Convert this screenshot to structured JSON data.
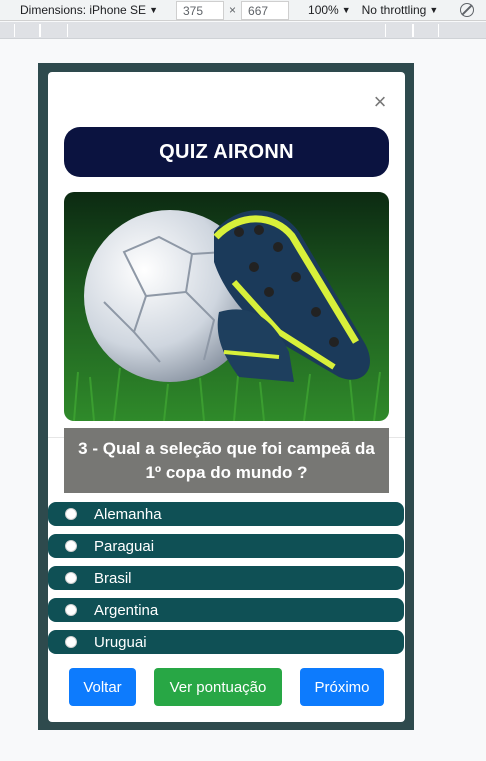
{
  "devtools": {
    "device_label": "Dimensions: iPhone SE",
    "width": "375",
    "times": "×",
    "height": "667",
    "zoom": "100%",
    "throttle": "No throttling"
  },
  "modal": {
    "close_glyph": "×",
    "title": "QUIZ AIRONN",
    "image_icon": "soccer-ball-and-boots-photo",
    "question": "3 - Qual a seleção que foi campeã da 1º copa do mundo ?",
    "options": [
      "Alemanha",
      "Paraguai",
      "Brasil",
      "Argentina",
      "Uruguai"
    ],
    "buttons": {
      "back": "Voltar",
      "score": "Ver pontuação",
      "next": "Próximo"
    }
  },
  "colors": {
    "frame": "#2e4a4d",
    "title_bg": "#0b1340",
    "question_bg": "#777774",
    "option_bg": "#0f5055",
    "primary": "#0d7bfd",
    "success": "#28a745"
  }
}
